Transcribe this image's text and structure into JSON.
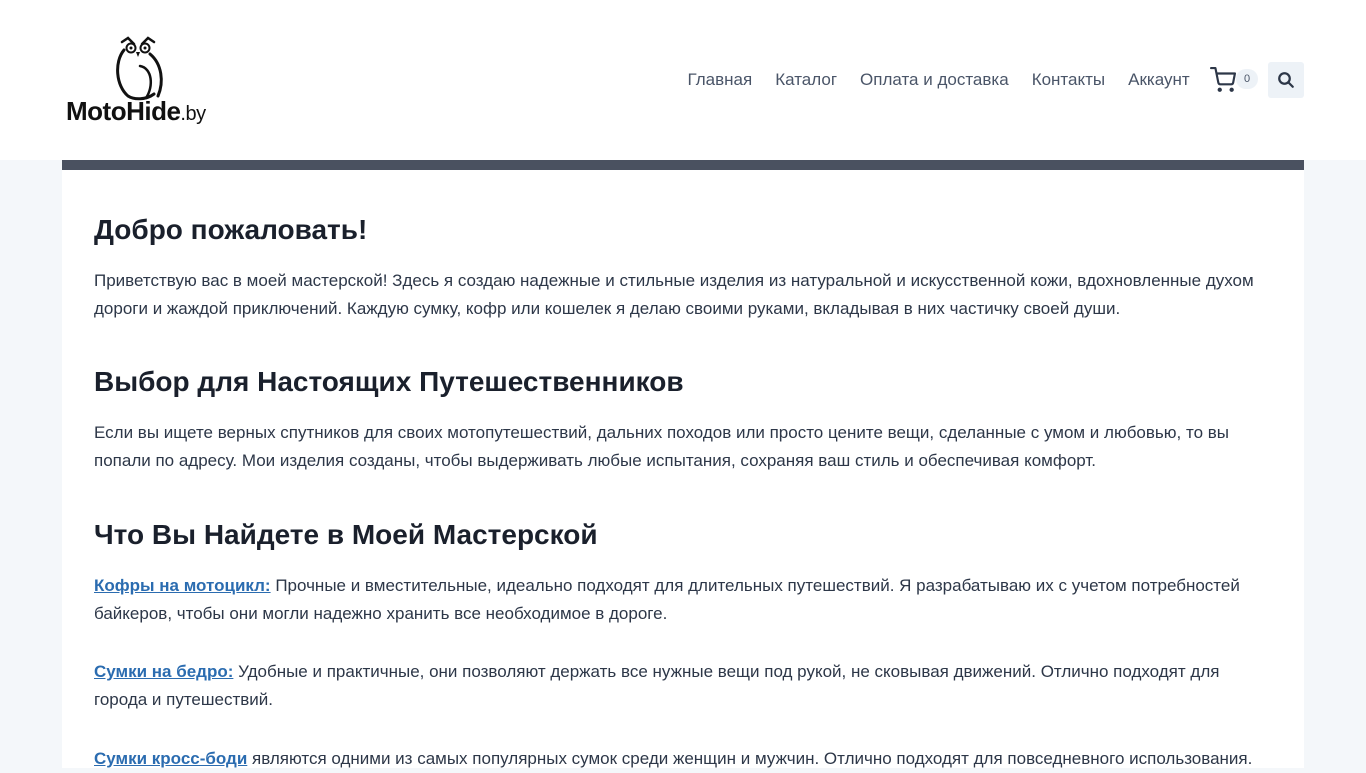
{
  "header": {
    "logo": {
      "name": "MotoHide",
      "suffix": ".by"
    },
    "nav": [
      {
        "label": "Главная"
      },
      {
        "label": "Каталог"
      },
      {
        "label": "Оплата и доставка"
      },
      {
        "label": "Контакты"
      },
      {
        "label": "Аккаунт"
      }
    ],
    "cart": {
      "icon": "cart-icon",
      "count": "0"
    },
    "search": {
      "icon": "search-icon"
    }
  },
  "content": {
    "welcome": {
      "title": "Добро пожаловать!",
      "text": "Приветствую вас в моей мастерской! Здесь я создаю надежные и стильные изделия из натуральной и искусственной кожи, вдохновленные духом дороги и жаждой приключений. Каждую сумку, кофр или кошелек я делаю своими руками, вкладывая в них частичку своей души."
    },
    "travelers": {
      "title": "Выбор для Настоящих Путешественников",
      "text": "Если вы ищете верных спутников для своих мотопутешествий, дальних походов или просто цените вещи, сделанные с умом и любовью, то вы попали по адресу. Мои изделия созданы, чтобы выдерживать любые испытания, сохраняя ваш стиль и обеспечивая комфорт."
    },
    "workshop": {
      "title": "Что Вы Найдете в Моей Мастерской",
      "items": [
        {
          "link": "Кофры на мотоцикл:",
          "text": " Прочные и вместительные, идеально подходят для длительных путешествий. Я разрабатываю их с учетом потребностей байкеров, чтобы они могли надежно хранить все необходимое в дороге."
        },
        {
          "link": "Сумки на бедро:",
          "text": " Удобные и практичные, они позволяют держать все нужные вещи под рукой, не сковывая движений. Отлично подходят для города и путешествий."
        },
        {
          "link": "Сумки кросс-боди",
          "text": " являются одними из самых популярных сумок среди женщин и мужчин. Отлично подходят для повседневного использования."
        }
      ]
    }
  }
}
